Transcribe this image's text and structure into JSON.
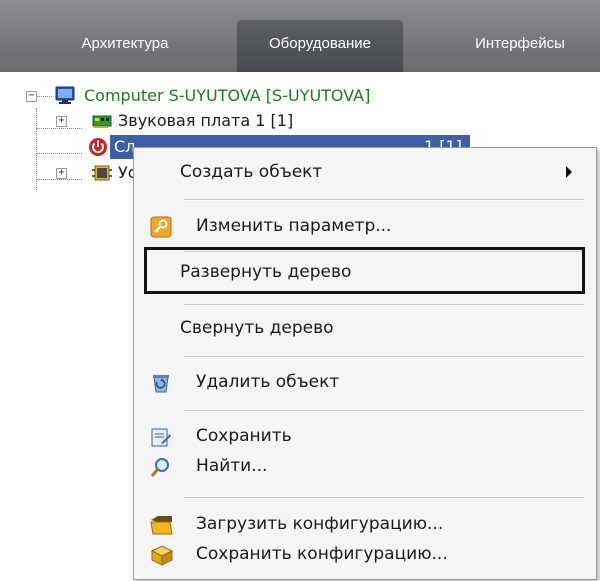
{
  "tabs": [
    {
      "label": "Архитектура",
      "active": false
    },
    {
      "label": "Оборудование",
      "active": true
    },
    {
      "label": "Интерфейсы",
      "active": false
    }
  ],
  "tree": {
    "root": {
      "label": "Computer S-UYUTOVA [S-UYUTOVA]",
      "expander": "−"
    },
    "items": [
      {
        "label": "Звуковая плата 1 [1]",
        "expander": "+"
      },
      {
        "label": "Сл",
        "label_tail": "1 [1]",
        "selected": true
      },
      {
        "label": "Ус",
        "expander": "+"
      }
    ]
  },
  "context_menu": {
    "items": [
      {
        "label": "Создать объект",
        "has_submenu": true
      },
      {
        "label": "Изменить параметр...",
        "icon": "key-icon"
      },
      {
        "label": "Развернуть дерево",
        "highlighted": true
      },
      {
        "label": "Свернуть дерево"
      },
      {
        "label": "Удалить объект",
        "icon": "delete-icon"
      },
      {
        "label": "Сохранить",
        "icon": "save-icon"
      },
      {
        "label": "Найти...",
        "icon": "search-icon"
      },
      {
        "label": "Загрузить конфигурацию...",
        "icon": "load-config-icon"
      },
      {
        "label": "Сохранить конфигурацию...",
        "icon": "save-config-icon"
      }
    ]
  },
  "colors": {
    "tabbar": "#7a7c80",
    "active_tab": "#4f5256",
    "selection": "#3e5fa8",
    "root_label": "#1e7a1e",
    "highlight_border": "#111111"
  }
}
